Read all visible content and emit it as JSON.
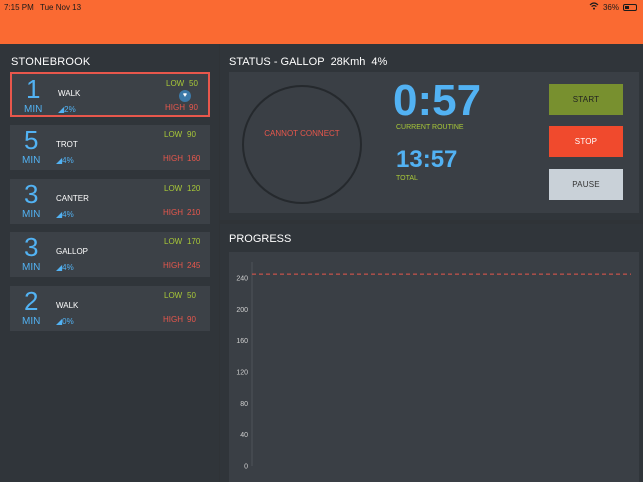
{
  "status_bar": {
    "time": "7:15 PM",
    "date": "Tue Nov 13",
    "battery": "36%",
    "battery_level": 0.36,
    "wifi_icon": "wifi-icon"
  },
  "colors": {
    "accent": "#fa6a32",
    "blue": "#52b2f3",
    "green": "#a8c838",
    "red": "#e8574c"
  },
  "routine": {
    "title": "STONEBROOK",
    "items": [
      {
        "minutes": "1",
        "unit": "MIN",
        "name": "WALK",
        "incline": "2%",
        "low_label": "LOW",
        "low": "50",
        "high_label": "HIGH",
        "high": "90",
        "selected": true
      },
      {
        "minutes": "5",
        "unit": "MIN",
        "name": "TROT",
        "incline": "4%",
        "low_label": "LOW",
        "low": "90",
        "high_label": "HIGH",
        "high": "160",
        "selected": false
      },
      {
        "minutes": "3",
        "unit": "MIN",
        "name": "CANTER",
        "incline": "4%",
        "low_label": "LOW",
        "low": "120",
        "high_label": "HIGH",
        "high": "210",
        "selected": false
      },
      {
        "minutes": "3",
        "unit": "MIN",
        "name": "GALLOP",
        "incline": "4%",
        "low_label": "LOW",
        "low": "170",
        "high_label": "HIGH",
        "high": "245",
        "selected": false
      },
      {
        "minutes": "2",
        "unit": "MIN",
        "name": "WALK",
        "incline": "0%",
        "low_label": "LOW",
        "low": "50",
        "high_label": "HIGH",
        "high": "90",
        "selected": false
      }
    ]
  },
  "status": {
    "title": "STATUS - GALLOP",
    "speed": "28Kmh",
    "incline": "4%",
    "connection": "CANNOT CONNECT",
    "current_time": "0:57",
    "current_label": "CURRENT ROUTINE",
    "total_time": "13:57",
    "total_label": "TOTAL",
    "buttons": {
      "start": "START",
      "stop": "STOP",
      "pause": "PAUSE"
    }
  },
  "progress": {
    "title": "PROGRESS",
    "chart_data": {
      "type": "line",
      "y_ticks": [
        "0",
        "40",
        "80",
        "120",
        "160",
        "200",
        "240"
      ],
      "ylim": [
        0,
        240
      ],
      "limit_line": 245,
      "series": [],
      "grid": false
    }
  }
}
